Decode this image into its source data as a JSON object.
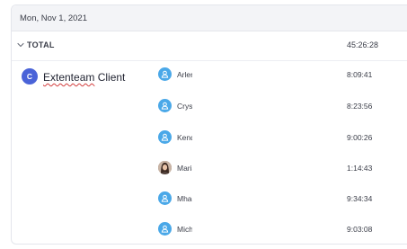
{
  "report": {
    "date": "Mon, Nov 1, 2021",
    "total_label": "TOTAL",
    "total_time": "45:26:28"
  },
  "client": {
    "initial": "C",
    "name_misspelled": "Extenteam",
    "name_rest": " Client",
    "avatar_color": "#4a63d8"
  },
  "users": [
    {
      "name": "Arlene",
      "time": "8:09:41",
      "avatar": "default-user-icon"
    },
    {
      "name": "Crystal",
      "time": "8:23:56",
      "avatar": "default-user-icon"
    },
    {
      "name": "Kendra",
      "time": "9:00:26",
      "avatar": "default-user-icon"
    },
    {
      "name": "Maria",
      "time": "1:14:43",
      "avatar": "photo"
    },
    {
      "name": "Mhae",
      "time": "9:34:34",
      "avatar": "default-user-icon"
    },
    {
      "name": "Michelle",
      "time": "9:03:08",
      "avatar": "default-user-icon"
    }
  ],
  "colors": {
    "user_avatar": "#4aa8e8",
    "header_bg": "#f3f4f7"
  }
}
